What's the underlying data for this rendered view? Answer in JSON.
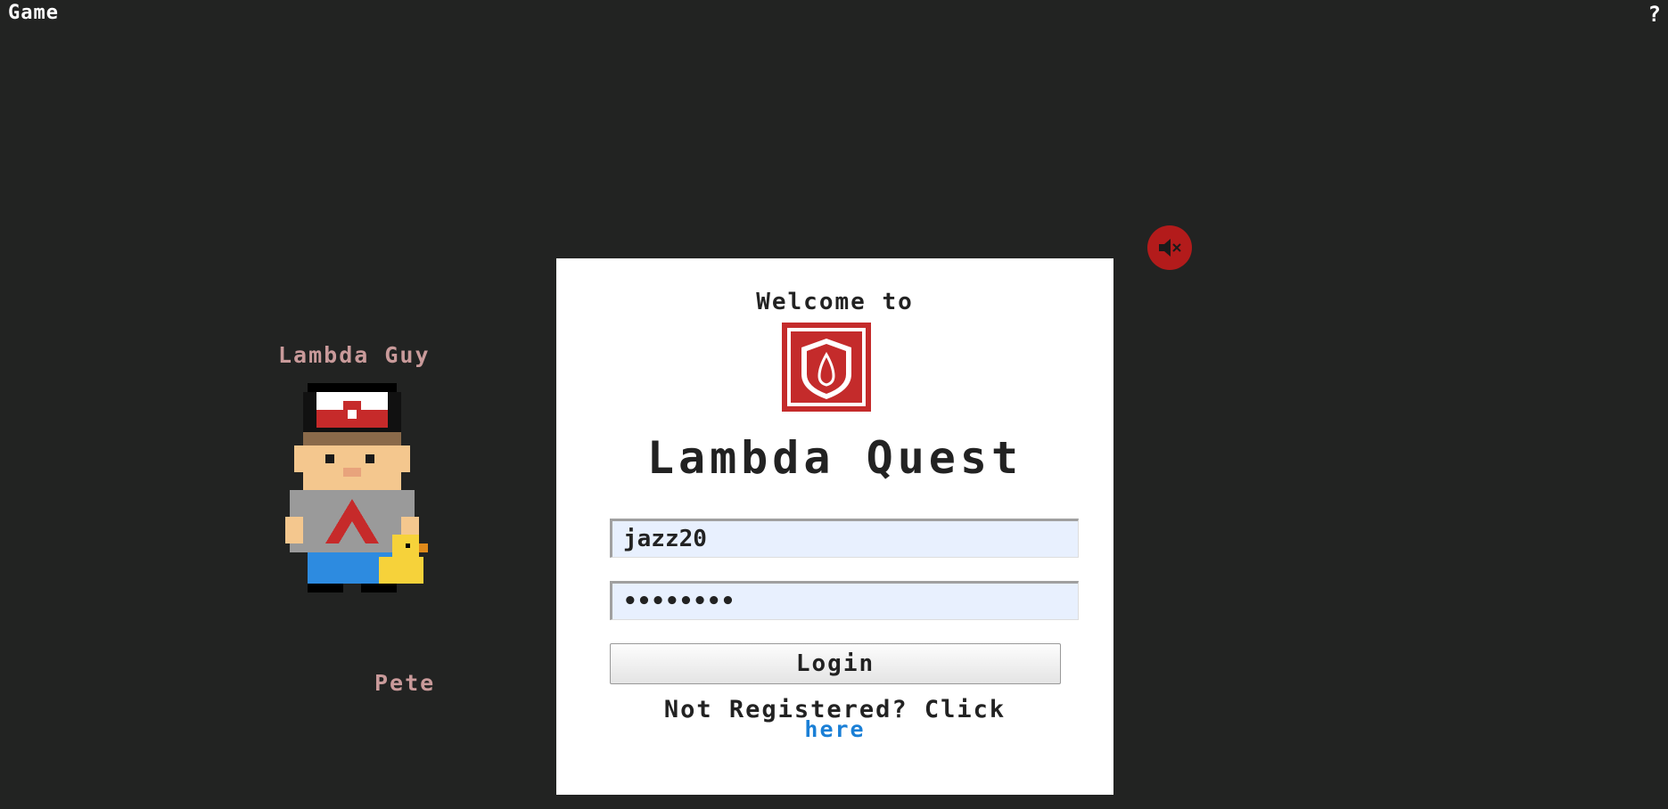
{
  "topbar": {
    "title": "Game",
    "help_icon_glyph": "?"
  },
  "characters": {
    "top_name": "Lambda Guy",
    "bottom_name": "Pete"
  },
  "sound": {
    "state": "muted",
    "icon": "speaker-muted-icon",
    "color": "#b31b1b"
  },
  "login": {
    "welcome": "Welcome to",
    "game_title": "Lambda Quest",
    "username_value": "jazz20",
    "password_value": "········",
    "login_label": "Login",
    "register_prompt": "Not Registered? Click",
    "register_link": "here"
  },
  "colors": {
    "background": "#222322",
    "brand_red": "#b31b1b",
    "link": "#1a7fd6",
    "name_tag": "#c99a9a"
  }
}
